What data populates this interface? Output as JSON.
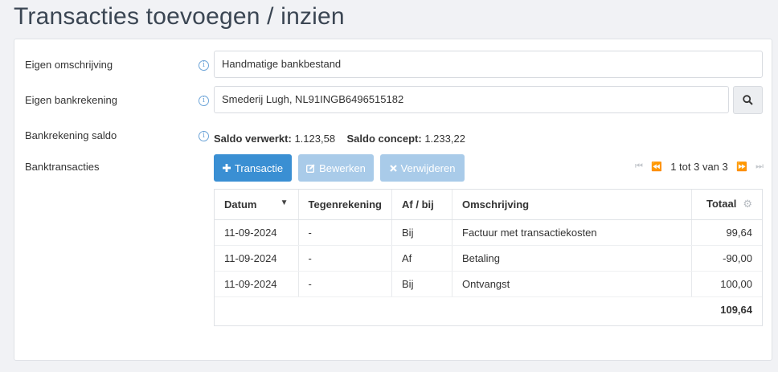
{
  "page": {
    "title": "Transacties toevoegen / inzien"
  },
  "form": {
    "own_description": {
      "label": "Eigen omschrijving",
      "value": "Handmatige bankbestand"
    },
    "own_bank_account": {
      "label": "Eigen bankrekening",
      "value": "Smederij Lugh, NL91INGB6496515182"
    },
    "bank_balance": {
      "label": "Bankrekening saldo",
      "processed_label": "Saldo verwerkt:",
      "processed_value": "1.123,58",
      "concept_label": "Saldo concept:",
      "concept_value": "1.233,22"
    },
    "bank_transactions": {
      "label": "Banktransacties"
    }
  },
  "toolbar": {
    "add_label": "Transactie",
    "edit_label": "Bewerken",
    "delete_label": "Verwijderen"
  },
  "pager": {
    "text": "1 tot 3 van 3"
  },
  "table": {
    "headers": {
      "date": "Datum",
      "counter_account": "Tegenrekening",
      "direction": "Af / bij",
      "description": "Omschrijving",
      "total": "Totaal"
    },
    "rows": [
      {
        "date": "11-09-2024",
        "counter_account": "-",
        "direction": "Bij",
        "description": "Factuur met transactiekosten",
        "total": "99,64"
      },
      {
        "date": "11-09-2024",
        "counter_account": "-",
        "direction": "Af",
        "description": "Betaling",
        "total": "-90,00"
      },
      {
        "date": "11-09-2024",
        "counter_account": "-",
        "direction": "Bij",
        "description": "Ontvangst",
        "total": "100,00"
      }
    ],
    "sum": "109,64"
  },
  "icons": {
    "info": "info-icon",
    "search": "search-icon",
    "plus": "plus-icon",
    "edit": "edit-icon",
    "delete": "x-icon",
    "first": "first-page-icon",
    "prev": "prev-page-icon",
    "next": "next-page-icon",
    "last": "last-page-icon",
    "sort": "sort-desc-icon",
    "settings": "gear-icon"
  },
  "colors": {
    "primary": "#3a8fd3",
    "disabled": "#a9cbe9",
    "title": "#3b4653"
  }
}
